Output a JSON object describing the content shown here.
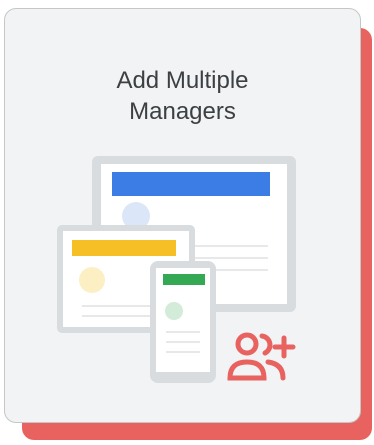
{
  "card": {
    "title_line1": "Add Multiple",
    "title_line2": "Managers"
  },
  "colors": {
    "accent": "#e8625f",
    "blue": "#3c7de5",
    "yellow": "#f6bf26",
    "green": "#34a853",
    "screen_bg": "#ffffff",
    "frame": "#d9dcdf"
  },
  "icons": {
    "add_managers": "add-people-icon"
  }
}
